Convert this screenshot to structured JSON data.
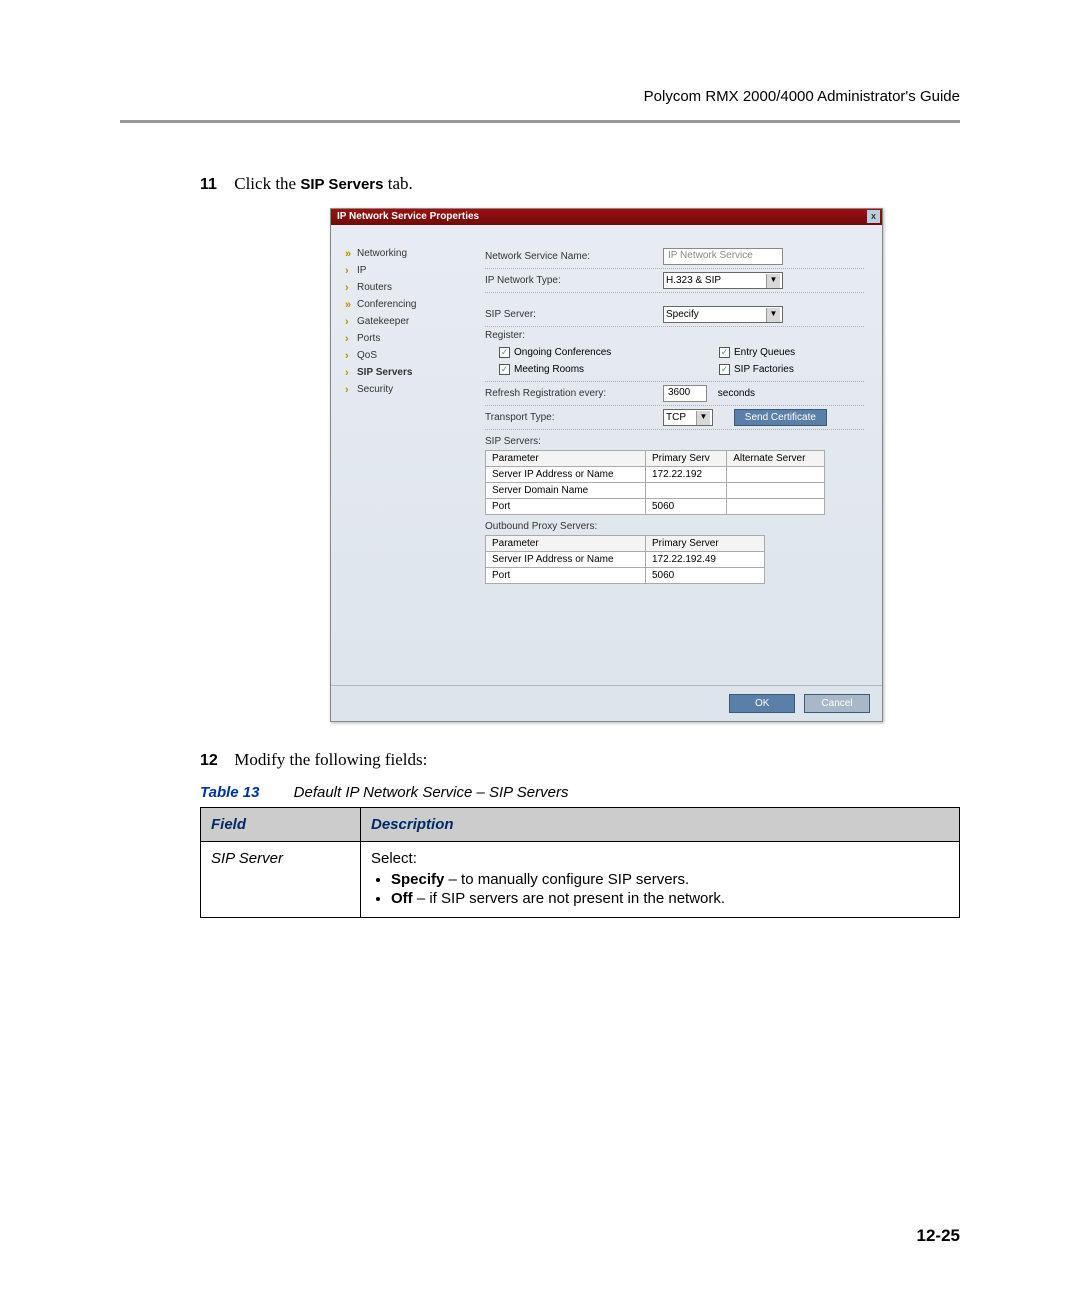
{
  "header": "Polycom RMX 2000/4000 Administrator's Guide",
  "step11": {
    "num": "11",
    "prefix": "Click the ",
    "bold": "SIP Servers",
    "suffix": " tab."
  },
  "dialog": {
    "title": "IP Network Service Properties",
    "close": "x",
    "sidebar": [
      {
        "label": "Networking",
        "parent": true
      },
      {
        "label": "IP"
      },
      {
        "label": "Routers"
      },
      {
        "label": "Conferencing",
        "parent": true
      },
      {
        "label": "Gatekeeper"
      },
      {
        "label": "Ports"
      },
      {
        "label": "QoS"
      },
      {
        "label": "SIP Servers",
        "active": true
      },
      {
        "label": "Security"
      }
    ],
    "fields": {
      "net_name_label": "Network Service Name:",
      "net_name_value": "IP Network Service",
      "ip_type_label": "IP Network Type:",
      "ip_type_value": "H.323 & SIP",
      "sip_server_label": "SIP Server:",
      "sip_server_value": "Specify",
      "register_label": "Register:",
      "cb_ongoing": "Ongoing Conferences",
      "cb_entry": "Entry Queues",
      "cb_meeting": "Meeting Rooms",
      "cb_factories": "SIP Factories",
      "refresh_label": "Refresh Registration every:",
      "refresh_value": "3600",
      "refresh_unit": "seconds",
      "transport_label": "Transport Type:",
      "transport_value": "TCP",
      "send_cert": "Send Certificate",
      "sip_servers_header": "SIP Servers:",
      "t1_h1": "Parameter",
      "t1_h2": "Primary Serv",
      "t1_h3": "Alternate Server",
      "t1_r1_a": "Server IP Address or Name",
      "t1_r1_b": "172.22.192",
      "t1_r2_a": "Server Domain Name",
      "t1_r2_b": "",
      "t1_r3_a": "Port",
      "t1_r3_b": "5060",
      "outbound_header": "Outbound Proxy Servers:",
      "t2_h1": "Parameter",
      "t2_h2": "Primary Server",
      "t2_r1_a": "Server IP Address or Name",
      "t2_r1_b": "172.22.192.49",
      "t2_r2_a": "Port",
      "t2_r2_b": "5060"
    },
    "ok": "OK",
    "cancel": "Cancel"
  },
  "step12": {
    "num": "12",
    "text": "Modify the following fields:"
  },
  "table": {
    "label": "Table 13",
    "caption": "Default IP Network Service – SIP Servers",
    "h_field": "Field",
    "h_desc": "Description",
    "row1_field": "SIP Server",
    "row1_desc_lead": "Select:",
    "row1_b1_bold": "Specify",
    "row1_b1_rest": " – to manually configure SIP servers.",
    "row1_b2_bold": "Off",
    "row1_b2_rest": " – if SIP servers are not present in the network."
  },
  "page": "12-25"
}
